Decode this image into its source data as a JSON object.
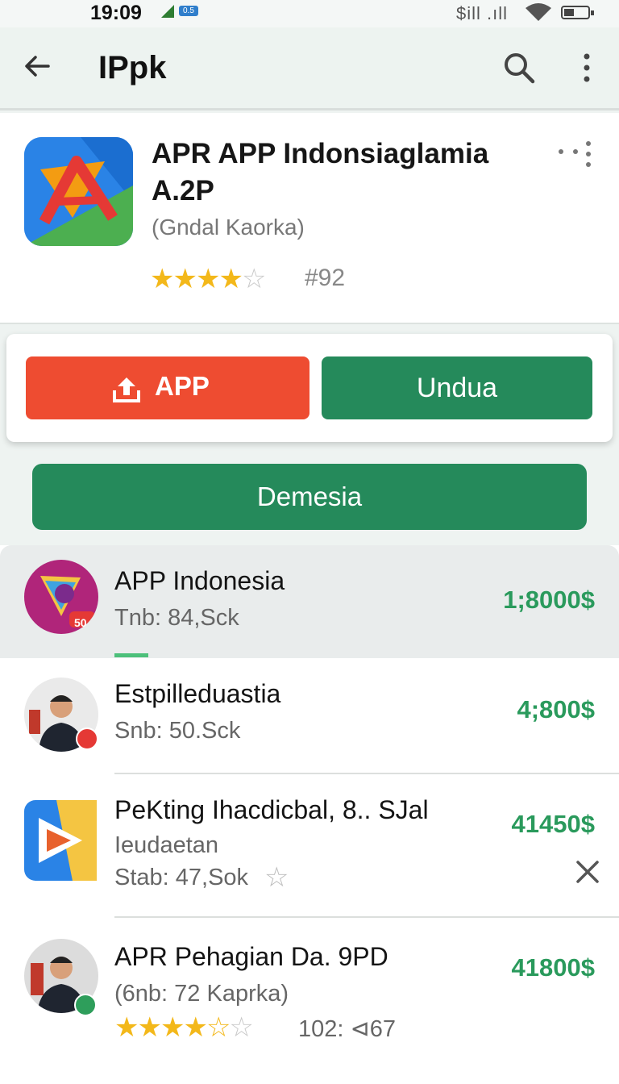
{
  "status_bar": {
    "time": "19:09",
    "sim_badge": "0.5",
    "signal_text": "$ill .ıll"
  },
  "app_bar": {
    "title": "IPpk",
    "icons": [
      "back-arrow-icon",
      "search-icon",
      "overflow-menu-icon"
    ]
  },
  "app_header": {
    "name": "APR APP Indonsiaglamia A.2P",
    "developer": "(Gndal Kaorka)",
    "rating_stars": 3.5,
    "rank": "#92"
  },
  "actions": {
    "primary_label": "APP",
    "secondary_label": "Undua",
    "tertiary_label": "Demesia"
  },
  "list": {
    "items": [
      {
        "title": "APP Indonesia",
        "subtitle": "Tnb: 84,Sck",
        "price": "1;8000$",
        "badge": "50"
      },
      {
        "title": "Estpilleduastia",
        "subtitle": "Snb: 50.Sck",
        "price": "4;800$"
      },
      {
        "title": "PeKting Ihacdicbal, 8.. SJal",
        "subtitle": "Ieudaetan",
        "meta": "Stab: 47,Sok",
        "price": "41450$"
      },
      {
        "title": "APR Pehagian Da. 9PD",
        "subtitle": "(6nb: 72 Kaprka)",
        "price": "41800$",
        "rating_stars": 3.5,
        "meta": "102: ⊲67"
      }
    ]
  },
  "colors": {
    "red_button": "#ee4c31",
    "green_button": "#258a5b",
    "price_green": "#2a9a5c",
    "star": "#f3b81a"
  }
}
